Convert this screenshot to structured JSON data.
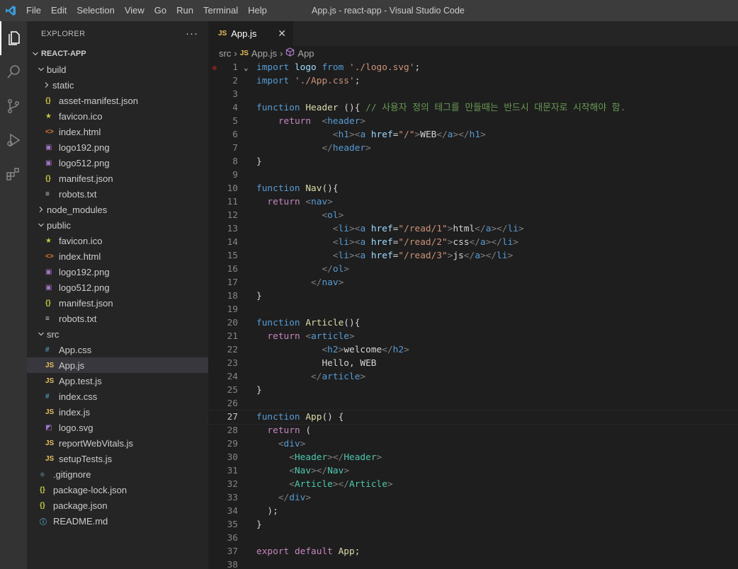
{
  "window": {
    "title": "App.js - react-app - Visual Studio Code",
    "menu": [
      "File",
      "Edit",
      "Selection",
      "View",
      "Go",
      "Run",
      "Terminal",
      "Help"
    ]
  },
  "sidebar": {
    "title": "EXPLORER",
    "more": "···",
    "root": "REACT-APP",
    "items": [
      {
        "label": "build",
        "type": "folder-open",
        "depth": 1
      },
      {
        "label": "static",
        "type": "folder-closed",
        "depth": 2
      },
      {
        "label": "asset-manifest.json",
        "type": "json",
        "depth": 2
      },
      {
        "label": "favicon.ico",
        "type": "ico",
        "depth": 2
      },
      {
        "label": "index.html",
        "type": "html",
        "depth": 2
      },
      {
        "label": "logo192.png",
        "type": "img",
        "depth": 2
      },
      {
        "label": "logo512.png",
        "type": "img",
        "depth": 2
      },
      {
        "label": "manifest.json",
        "type": "json",
        "depth": 2
      },
      {
        "label": "robots.txt",
        "type": "txt",
        "depth": 2
      },
      {
        "label": "node_modules",
        "type": "folder-closed",
        "depth": 1
      },
      {
        "label": "public",
        "type": "folder-open",
        "depth": 1
      },
      {
        "label": "favicon.ico",
        "type": "ico",
        "depth": 2
      },
      {
        "label": "index.html",
        "type": "html",
        "depth": 2
      },
      {
        "label": "logo192.png",
        "type": "img",
        "depth": 2
      },
      {
        "label": "logo512.png",
        "type": "img",
        "depth": 2
      },
      {
        "label": "manifest.json",
        "type": "json",
        "depth": 2
      },
      {
        "label": "robots.txt",
        "type": "txt",
        "depth": 2
      },
      {
        "label": "src",
        "type": "folder-open",
        "depth": 1
      },
      {
        "label": "App.css",
        "type": "css",
        "depth": 2
      },
      {
        "label": "App.js",
        "type": "js",
        "depth": 2,
        "selected": true
      },
      {
        "label": "App.test.js",
        "type": "js",
        "depth": 2
      },
      {
        "label": "index.css",
        "type": "css",
        "depth": 2
      },
      {
        "label": "index.js",
        "type": "js",
        "depth": 2
      },
      {
        "label": "logo.svg",
        "type": "svg",
        "depth": 2
      },
      {
        "label": "reportWebVitals.js",
        "type": "js",
        "depth": 2
      },
      {
        "label": "setupTests.js",
        "type": "js",
        "depth": 2
      },
      {
        "label": ".gitignore",
        "type": "git",
        "depth": 1
      },
      {
        "label": "package-lock.json",
        "type": "json",
        "depth": 1
      },
      {
        "label": "package.json",
        "type": "json",
        "depth": 1
      },
      {
        "label": "README.md",
        "type": "md",
        "depth": 1
      }
    ]
  },
  "editor": {
    "tab": {
      "badge": "JS",
      "label": "App.js",
      "close": "✕"
    },
    "breadcrumb": [
      "src",
      "App.js",
      "App"
    ],
    "active_line": 27,
    "breakpoint_line": 1,
    "lines": [
      [
        [
          "kw",
          "import "
        ],
        [
          "var",
          "logo "
        ],
        [
          "kw",
          "from "
        ],
        [
          "str",
          "'./logo.svg'"
        ],
        [
          "t",
          ";"
        ]
      ],
      [
        [
          "kw",
          "import "
        ],
        [
          "str",
          "'./App.css'"
        ],
        [
          "t",
          ";"
        ]
      ],
      [],
      [
        [
          "kw",
          "function "
        ],
        [
          "fn",
          "Header "
        ],
        [
          "t",
          "(){ "
        ],
        [
          "cm",
          "// 사용자 정의 테그를 만들때는 반드시 대문자로 시작해야 함."
        ]
      ],
      [
        [
          "t",
          "    "
        ],
        [
          "ctl",
          "return  "
        ],
        [
          "pu",
          "<"
        ],
        [
          "tg",
          "header"
        ],
        [
          "pu",
          ">"
        ]
      ],
      [
        [
          "t",
          "              "
        ],
        [
          "pu",
          "<"
        ],
        [
          "tg",
          "h1"
        ],
        [
          "pu",
          "><"
        ],
        [
          "tg",
          "a "
        ],
        [
          "var",
          "href"
        ],
        [
          "t",
          "="
        ],
        [
          "str",
          "\"/\""
        ],
        [
          "pu",
          ">"
        ],
        [
          "t",
          "WEB"
        ],
        [
          "pu",
          "</"
        ],
        [
          "tg",
          "a"
        ],
        [
          "pu",
          "></"
        ],
        [
          "tg",
          "h1"
        ],
        [
          "pu",
          ">"
        ]
      ],
      [
        [
          "t",
          "            "
        ],
        [
          "pu",
          "</"
        ],
        [
          "tg",
          "header"
        ],
        [
          "pu",
          ">"
        ]
      ],
      [
        [
          "t",
          "}"
        ]
      ],
      [],
      [
        [
          "kw",
          "function "
        ],
        [
          "fn",
          "Nav"
        ],
        [
          "t",
          "(){"
        ]
      ],
      [
        [
          "t",
          "  "
        ],
        [
          "ctl",
          "return "
        ],
        [
          "pu",
          "<"
        ],
        [
          "tg",
          "nav"
        ],
        [
          "pu",
          ">"
        ]
      ],
      [
        [
          "t",
          "            "
        ],
        [
          "pu",
          "<"
        ],
        [
          "tg",
          "ol"
        ],
        [
          "pu",
          ">"
        ]
      ],
      [
        [
          "t",
          "              "
        ],
        [
          "pu",
          "<"
        ],
        [
          "tg",
          "li"
        ],
        [
          "pu",
          "><"
        ],
        [
          "tg",
          "a "
        ],
        [
          "var",
          "href"
        ],
        [
          "t",
          "="
        ],
        [
          "str",
          "\"/read/1\""
        ],
        [
          "pu",
          ">"
        ],
        [
          "t",
          "html"
        ],
        [
          "pu",
          "</"
        ],
        [
          "tg",
          "a"
        ],
        [
          "pu",
          "></"
        ],
        [
          "tg",
          "li"
        ],
        [
          "pu",
          ">"
        ]
      ],
      [
        [
          "t",
          "              "
        ],
        [
          "pu",
          "<"
        ],
        [
          "tg",
          "li"
        ],
        [
          "pu",
          "><"
        ],
        [
          "tg",
          "a "
        ],
        [
          "var",
          "href"
        ],
        [
          "t",
          "="
        ],
        [
          "str",
          "\"/read/2\""
        ],
        [
          "pu",
          ">"
        ],
        [
          "t",
          "css"
        ],
        [
          "pu",
          "</"
        ],
        [
          "tg",
          "a"
        ],
        [
          "pu",
          "></"
        ],
        [
          "tg",
          "li"
        ],
        [
          "pu",
          ">"
        ]
      ],
      [
        [
          "t",
          "              "
        ],
        [
          "pu",
          "<"
        ],
        [
          "tg",
          "li"
        ],
        [
          "pu",
          "><"
        ],
        [
          "tg",
          "a "
        ],
        [
          "var",
          "href"
        ],
        [
          "t",
          "="
        ],
        [
          "str",
          "\"/read/3\""
        ],
        [
          "pu",
          ">"
        ],
        [
          "t",
          "js"
        ],
        [
          "pu",
          "</"
        ],
        [
          "tg",
          "a"
        ],
        [
          "pu",
          "></"
        ],
        [
          "tg",
          "li"
        ],
        [
          "pu",
          ">"
        ]
      ],
      [
        [
          "t",
          "            "
        ],
        [
          "pu",
          "</"
        ],
        [
          "tg",
          "ol"
        ],
        [
          "pu",
          ">"
        ]
      ],
      [
        [
          "t",
          "          "
        ],
        [
          "pu",
          "</"
        ],
        [
          "tg",
          "nav"
        ],
        [
          "pu",
          ">"
        ]
      ],
      [
        [
          "t",
          "}"
        ]
      ],
      [],
      [
        [
          "kw",
          "function "
        ],
        [
          "fn",
          "Article"
        ],
        [
          "t",
          "(){"
        ]
      ],
      [
        [
          "t",
          "  "
        ],
        [
          "ctl",
          "return "
        ],
        [
          "pu",
          "<"
        ],
        [
          "tg",
          "article"
        ],
        [
          "pu",
          ">"
        ]
      ],
      [
        [
          "t",
          "            "
        ],
        [
          "pu",
          "<"
        ],
        [
          "tg",
          "h2"
        ],
        [
          "pu",
          ">"
        ],
        [
          "t",
          "welcome"
        ],
        [
          "pu",
          "</"
        ],
        [
          "tg",
          "h2"
        ],
        [
          "pu",
          ">"
        ]
      ],
      [
        [
          "t",
          "            Hello, WEB"
        ]
      ],
      [
        [
          "t",
          "          "
        ],
        [
          "pu",
          "</"
        ],
        [
          "tg",
          "article"
        ],
        [
          "pu",
          ">"
        ]
      ],
      [
        [
          "t",
          "}"
        ]
      ],
      [],
      [
        [
          "kw",
          "function "
        ],
        [
          "fn",
          "App"
        ],
        [
          "t",
          "() {"
        ]
      ],
      [
        [
          "t",
          "  "
        ],
        [
          "ctl",
          "return "
        ],
        [
          "t",
          "("
        ]
      ],
      [
        [
          "t",
          "    "
        ],
        [
          "pu",
          "<"
        ],
        [
          "tg",
          "div"
        ],
        [
          "pu",
          ">"
        ]
      ],
      [
        [
          "t",
          "      "
        ],
        [
          "pu",
          "<"
        ],
        [
          "cp",
          "Header"
        ],
        [
          "pu",
          "></"
        ],
        [
          "cp",
          "Header"
        ],
        [
          "pu",
          ">"
        ]
      ],
      [
        [
          "t",
          "      "
        ],
        [
          "pu",
          "<"
        ],
        [
          "cp",
          "Nav"
        ],
        [
          "pu",
          "></"
        ],
        [
          "cp",
          "Nav"
        ],
        [
          "pu",
          ">"
        ]
      ],
      [
        [
          "t",
          "      "
        ],
        [
          "pu",
          "<"
        ],
        [
          "cp",
          "Article"
        ],
        [
          "pu",
          "></"
        ],
        [
          "cp",
          "Article"
        ],
        [
          "pu",
          ">"
        ]
      ],
      [
        [
          "t",
          "    "
        ],
        [
          "pu",
          "</"
        ],
        [
          "tg",
          "div"
        ],
        [
          "pu",
          ">"
        ]
      ],
      [
        [
          "t",
          "  );"
        ]
      ],
      [
        [
          "t",
          "}"
        ]
      ],
      [],
      [
        [
          "ctl",
          "export "
        ],
        [
          "ctl",
          "default "
        ],
        [
          "fn",
          "App"
        ],
        [
          "t",
          ";"
        ]
      ],
      []
    ]
  }
}
